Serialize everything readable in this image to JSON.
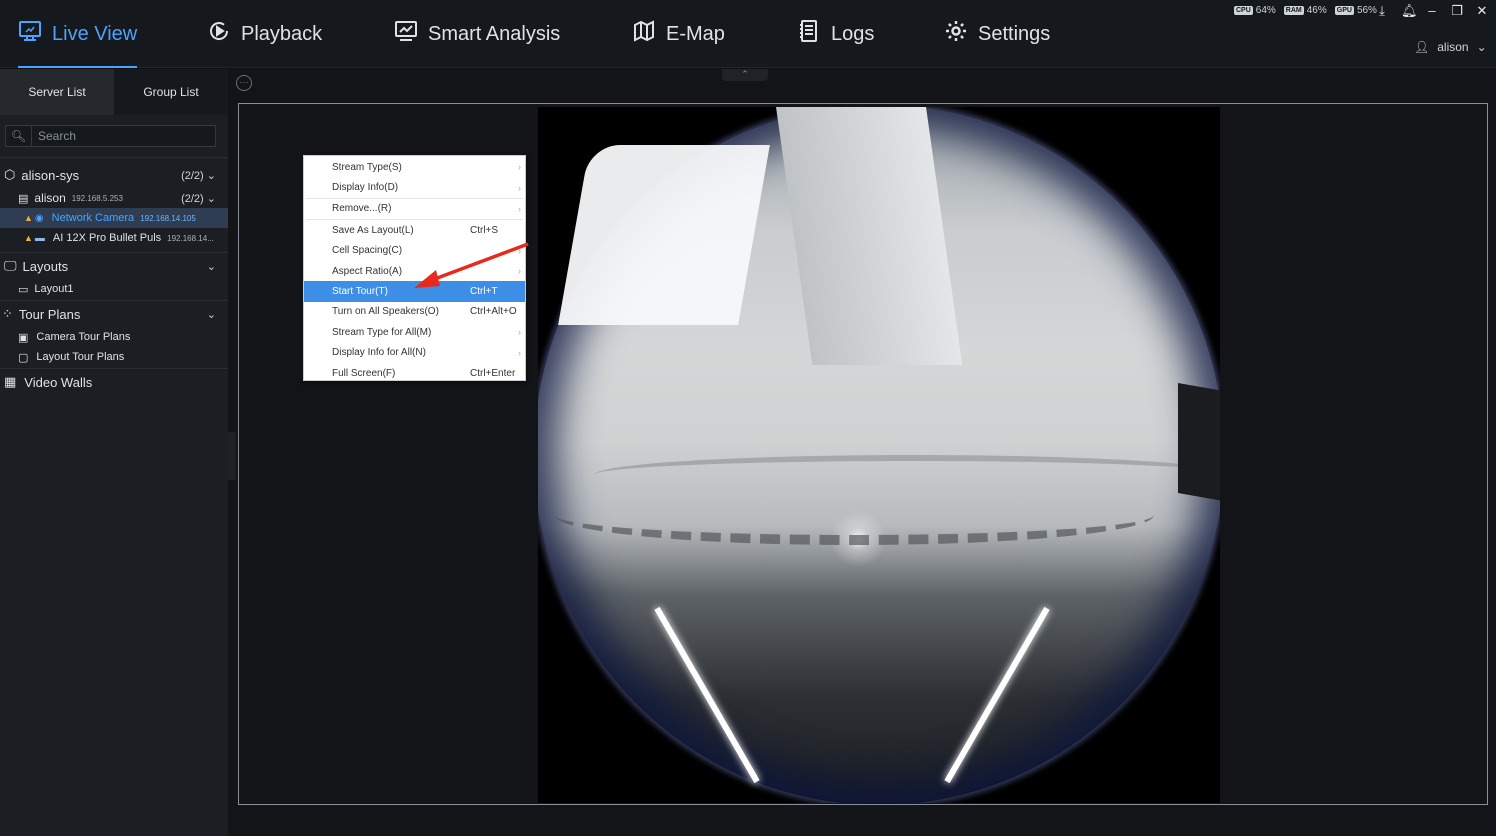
{
  "nav": {
    "items": [
      {
        "label": "Live View",
        "icon": "monitor-icon"
      },
      {
        "label": "Playback",
        "icon": "playback-icon"
      },
      {
        "label": "Smart Analysis",
        "icon": "analysis-icon"
      },
      {
        "label": "E-Map",
        "icon": "map-icon"
      },
      {
        "label": "Logs",
        "icon": "logs-icon"
      },
      {
        "label": "Settings",
        "icon": "gear-icon"
      }
    ],
    "active": "Live View"
  },
  "system": {
    "cpu_label": "CPU",
    "cpu": "64%",
    "ram_label": "RAM",
    "ram": "46%",
    "gpu_label": "GPU",
    "gpu": "56%"
  },
  "user": {
    "name": "alison"
  },
  "sidebar": {
    "tabs": [
      "Server List",
      "Group List"
    ],
    "search_placeholder": "Search",
    "server": {
      "name": "alison-sys",
      "count": "(2/2)"
    },
    "device": {
      "name": "alison",
      "ip": "192.168.5.253",
      "count": "(2/2)"
    },
    "cameras": [
      {
        "name": "Network Camera",
        "ip": "192.168.14.105"
      },
      {
        "name": "AI 12X Pro Bullet Puls",
        "ip": "192.168.14..."
      }
    ],
    "layouts": {
      "label": "Layouts",
      "items": [
        "Layout1"
      ]
    },
    "tour_plans": {
      "label": "Tour Plans",
      "items": [
        "Camera Tour Plans",
        "Layout Tour Plans"
      ]
    },
    "video_walls": {
      "label": "Video Walls"
    }
  },
  "context_menu": {
    "items": [
      {
        "label": "Stream Type(S)",
        "shortcut": "",
        "submenu": true
      },
      {
        "label": "Display Info(D)",
        "shortcut": "",
        "submenu": true
      },
      {
        "label": "Remove...(R)",
        "shortcut": "",
        "submenu": true
      },
      {
        "label": "Save As Layout(L)",
        "shortcut": "Ctrl+S",
        "submenu": false
      },
      {
        "label": "Cell Spacing(C)",
        "shortcut": "",
        "submenu": true
      },
      {
        "label": "Aspect Ratio(A)",
        "shortcut": "",
        "submenu": true
      },
      {
        "label": "Start Tour(T)",
        "shortcut": "Ctrl+T",
        "submenu": false,
        "highlighted": true
      },
      {
        "label": "Turn on All Speakers(O)",
        "shortcut": "Ctrl+Alt+O",
        "submenu": false
      },
      {
        "label": "Stream Type for All(M)",
        "shortcut": "",
        "submenu": true
      },
      {
        "label": "Display Info for All(N)",
        "shortcut": "",
        "submenu": true
      },
      {
        "label": "Full Screen(F)",
        "shortcut": "Ctrl+Enter",
        "submenu": false
      }
    ]
  },
  "colors": {
    "accent": "#4aa3ff",
    "highlight": "#3d8ee6",
    "warning": "#f2b035",
    "annotation_arrow": "#e8291c"
  }
}
